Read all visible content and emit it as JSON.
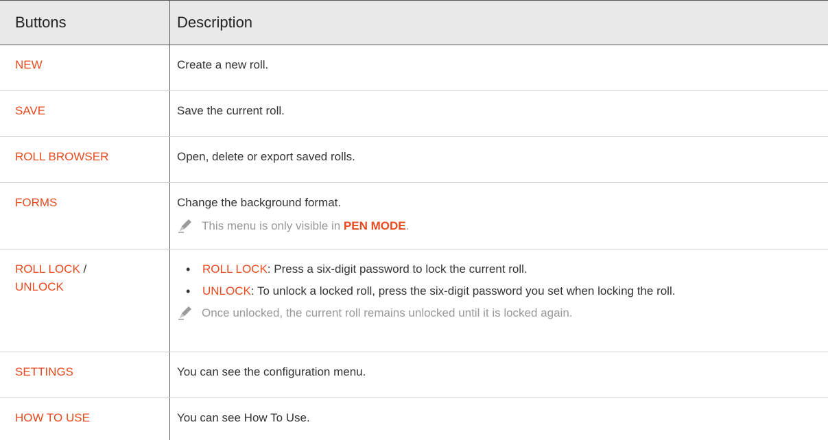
{
  "header": {
    "col1": "Buttons",
    "col2": "Description"
  },
  "rows": [
    {
      "button": "NEW",
      "desc": "Create a new roll."
    },
    {
      "button": "SAVE",
      "desc": "Save the current roll."
    },
    {
      "button": "ROLL BROWSER",
      "desc": "Open, delete or export saved rolls."
    },
    {
      "button": "FORMS",
      "desc": "Change the background format.",
      "note_pre": "This menu is only visible in ",
      "note_key": "PEN MODE",
      "note_post": "."
    },
    {
      "button": "ROLL LOCK",
      "button_sep": " /",
      "button2": "UNLOCK",
      "b1_key": "ROLL LOCK",
      "b1_text": ": Press a six-digit password to lock the current roll.",
      "b2_key": "UNLOCK",
      "b2_text": ": To unlock a locked roll, press the six-digit password you set when locking the roll.",
      "note": "Once unlocked, the current roll remains unlocked until it is locked again."
    },
    {
      "button": "SETTINGS",
      "desc": "You can see the configuration menu."
    },
    {
      "button": "HOW TO USE",
      "desc": "You can see How To Use."
    }
  ],
  "colors": {
    "accent": "#e8491d",
    "header_bg": "#e9e9e9",
    "note_gray": "#999999"
  },
  "icons": {
    "note": "pencil-note-icon"
  }
}
